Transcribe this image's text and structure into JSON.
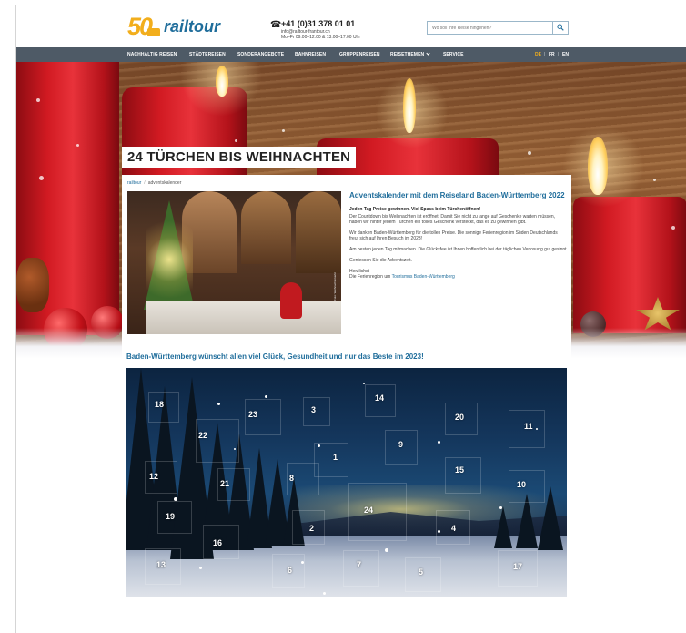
{
  "header": {
    "logo_number": "50",
    "logo_word": "railtour",
    "phone": "+41 (0)31 378 01 01",
    "email": "info@railtour-frantour.ch",
    "hours": "Mo–Fr 09.00–12.00 & 13.00–17.00 Uhr",
    "search_placeholder": "Wo soll Ihre Reise hingehen?"
  },
  "nav": {
    "items": [
      "NACHHALTIG REISEN",
      "STÄDTEREISEN",
      "SONDERANGEBOTE",
      "BAHNREISEN",
      "GRUPPENREISEN",
      "REISETHEMEN",
      "SERVICE"
    ],
    "languages": [
      "DE",
      "FR",
      "EN"
    ],
    "active_language": "DE"
  },
  "hero": {
    "title": "24 TÜRCHEN BIS WEIHNACHTEN"
  },
  "breadcrumb": {
    "home": "railtour",
    "current": "adventskalender"
  },
  "article": {
    "title": "Adventskalender mit dem Reiseland Baden-Württemberg 2022",
    "lead": "Jeden Tag Preise gewinnen. Viel Spass beim Türchenöffnen!",
    "p1": "Der Countdown bis Weihnachten ist eröffnet. Damit Sie nicht zu lange auf Geschenke warten müssen, haben wir hinter jedem Türchen ein tolles Geschenk versteckt, das es zu gewinnen gibt.",
    "p2": "Wir danken Baden-Württemberg für die tollen Preise. Die sonnige Ferienregion im Süden Deutschlands freut sich auf Ihren Besuch im 2023!",
    "p3": "Am besten jeden Tag mitmachen. Die Glücksfee ist Ihnen hoffentlich bei der täglichen Verlosung gut gesinnt.",
    "p4": "Geniessen Sie die Adventszeit.",
    "sign1": "Herzlichst",
    "sign2_prefix": "Die Ferienregion um ",
    "sign2_link": "Tourismus Baden-Württemberg",
    "photo_credit": "Foto: Weihnachtsmarkt"
  },
  "calendar": {
    "title": "Baden-Württemberg wünscht allen viel Glück, Gesundheit und nur das Beste im 2023!",
    "doors": [
      "18",
      "23",
      "3",
      "14",
      "20",
      "11",
      "22",
      "9",
      "1",
      "12",
      "21",
      "8",
      "15",
      "10",
      "19",
      "24",
      "2",
      "4",
      "16",
      "13",
      "6",
      "7",
      "5",
      "17"
    ]
  },
  "colors": {
    "accent_blue": "#1f6d9b",
    "logo_gold": "#f2ae1c",
    "nav_bg": "#4e5a66"
  }
}
